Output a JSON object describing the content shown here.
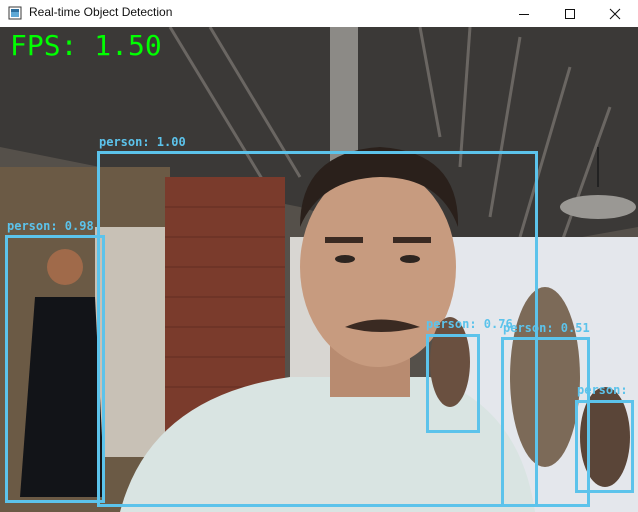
{
  "window": {
    "title": "Real-time Object Detection",
    "controls": {
      "minimize_icon": "minimize-icon",
      "maximize_icon": "maximize-icon",
      "close_icon": "close-icon"
    }
  },
  "overlay": {
    "fps_text": "FPS: 1.50",
    "fps_color": "#00ff00",
    "box_color": "#5cc3eb"
  },
  "detections": [
    {
      "label": "person: 1.00"
    },
    {
      "label": "person: 0.98"
    },
    {
      "label": "person: 0.76"
    },
    {
      "label": "person: 0.51"
    },
    {
      "label": "person:"
    }
  ]
}
